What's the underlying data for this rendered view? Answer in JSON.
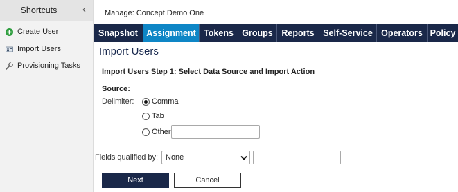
{
  "sidebar": {
    "title": "Shortcuts",
    "collapse_icon": "chevron-left-icon",
    "items": [
      {
        "label": "Create User",
        "icon": "plus-circle-icon",
        "icon_color": "#2e9e3e"
      },
      {
        "label": "Import Users",
        "icon": "import-users-icon"
      },
      {
        "label": "Provisioning Tasks",
        "icon": "wrench-icon"
      }
    ]
  },
  "header": {
    "manage_label": "Manage: Concept Demo One"
  },
  "tabs": [
    {
      "label": "Snapshot",
      "active": false
    },
    {
      "label": "Assignment",
      "active": true
    },
    {
      "label": "Tokens",
      "active": false
    },
    {
      "label": "Groups",
      "active": false
    },
    {
      "label": "Reports",
      "active": false
    },
    {
      "label": "Self-Service",
      "active": false
    },
    {
      "label": "Operators",
      "active": false
    },
    {
      "label": "Policy",
      "active": false
    }
  ],
  "colors": {
    "nav_bg": "#1a2849",
    "active_tab": "#0e86c6",
    "title_color": "#1a2a4f"
  },
  "main": {
    "page_title": "Import Users",
    "step_heading": "Import Users Step 1: Select Data Source and Import Action",
    "source_label": "Source:",
    "delimiter_label": "Delimiter:",
    "delimiter_options": [
      {
        "label": "Comma",
        "checked": true
      },
      {
        "label": "Tab",
        "checked": false
      },
      {
        "label": "Other",
        "checked": false
      }
    ],
    "other_value": "",
    "fields_qualified_label": "Fields qualified by:",
    "fields_qualified_selected": "None",
    "fields_qualified_text": ""
  },
  "buttons": {
    "next": "Next",
    "cancel": "Cancel"
  }
}
